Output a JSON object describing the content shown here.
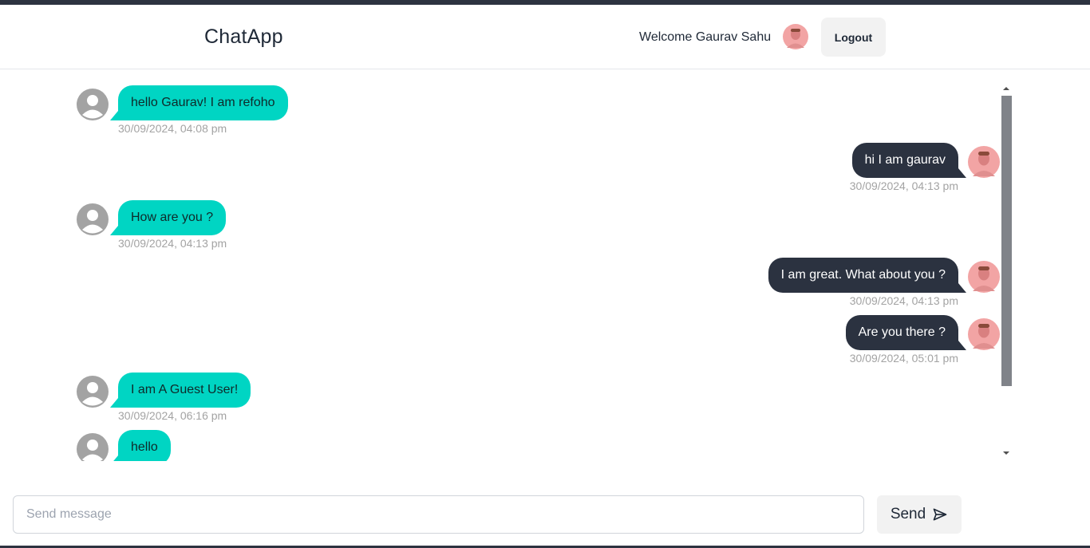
{
  "navbar": {
    "brand": "ChatApp",
    "welcome": "Welcome Gaurav Sahu",
    "logout_label": "Logout"
  },
  "messages": [
    {
      "direction": "in",
      "text": "hello Gaurav! I am refoho",
      "time": "30/09/2024, 04:08 pm"
    },
    {
      "direction": "out",
      "text": "hi I am gaurav",
      "time": "30/09/2024, 04:13 pm"
    },
    {
      "direction": "in",
      "text": "How are you ?",
      "time": "30/09/2024, 04:13 pm"
    },
    {
      "direction": "out",
      "text": "I am great. What about you ?",
      "time": "30/09/2024, 04:13 pm"
    },
    {
      "direction": "out",
      "text": "Are you there ?",
      "time": "30/09/2024, 05:01 pm"
    },
    {
      "direction": "in",
      "text": "I am A Guest User!",
      "time": "30/09/2024, 06:16 pm"
    },
    {
      "direction": "in",
      "text": "hello",
      "time": ""
    }
  ],
  "composer": {
    "placeholder": "Send message",
    "send_label": "Send"
  },
  "colors": {
    "incoming_bubble": "#00d5c3",
    "outgoing_bubble": "#2b3240",
    "timestamp": "#a3a3a3"
  },
  "icons": {
    "guest_avatar": "person-silhouette-icon",
    "user_avatar": "user-photo-avatar",
    "send": "paper-plane-icon"
  }
}
